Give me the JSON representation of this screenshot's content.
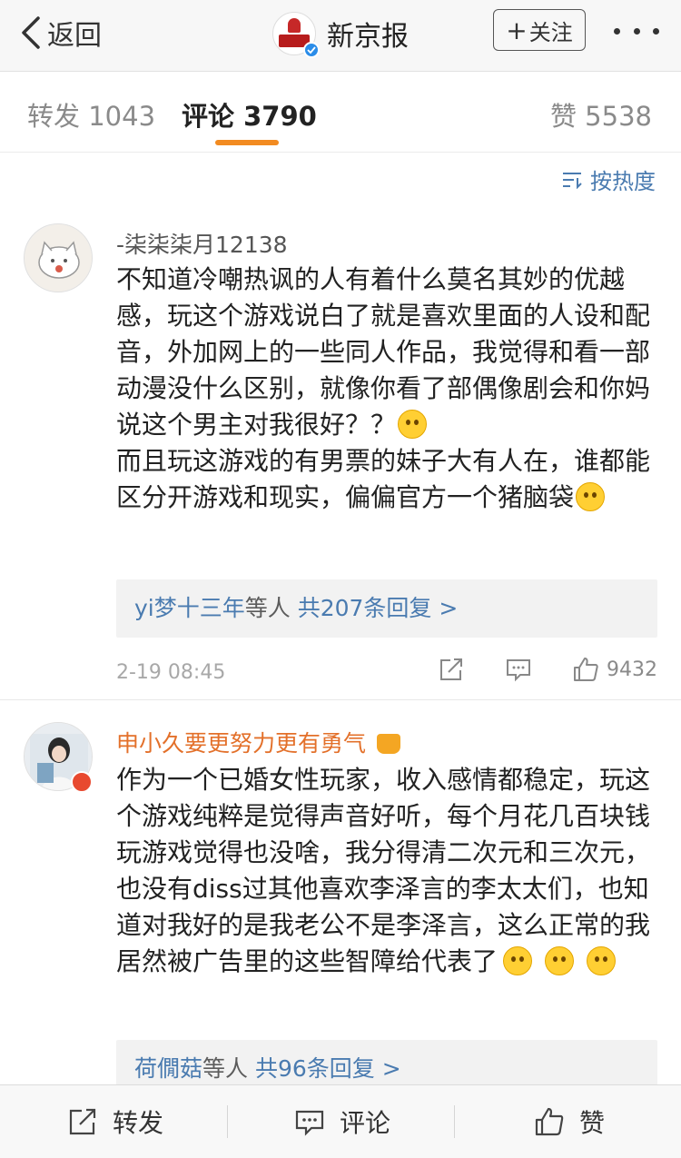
{
  "nav": {
    "back_label": "返回",
    "title": "新京报",
    "logo_text": "新京报",
    "follow_label": "关注",
    "follow_plus": "+"
  },
  "tabs": {
    "repost": "转发 1043",
    "comments": "评论 3790",
    "likes": "赞 5538"
  },
  "sort": {
    "label": "按热度"
  },
  "comments": [
    {
      "username": "-柒柒柒月12138",
      "text_1": "不知道冷嘲热讽的人有着什么莫名其妙的优越感，玩这个游戏说白了就是喜欢里面的人设和配音，外加网上的一些同人作品，我觉得和看一部动漫没什么区别，就像你看了部偶像剧会和你妈说这个男主对我很好？？",
      "text_2": "而且玩这游戏的有男票的妹子大有人在，谁都能区分开游戏和现实，偏偏官方一个猪脑袋",
      "reply_who": "yi梦十三年",
      "reply_mid": "等人",
      "reply_count": "共207条回复 >",
      "time": "2-19 08:45",
      "likes": "9432"
    },
    {
      "username": "申小久要更努力更有勇气",
      "text_1": "作为一个已婚女性玩家，收入感情都稳定，玩这个游戏纯粹是觉得声音好听，每个月花几百块钱玩游戏觉得也没啥，我分得清二次元和三次元，也没有diss过其他喜欢李泽言的李太太们，也知道对我好的是我老公不是李泽言，这么正常的我居然被广告里的这些智障给代表了",
      "reply_who": "荷僩菇",
      "reply_mid": "等人",
      "reply_count": "共96条回复 >"
    }
  ],
  "bottom": {
    "repost": "转发",
    "comment": "评论",
    "like": "赞"
  },
  "colors": {
    "accent_orange": "#f28b21",
    "link_blue": "#4a7bb0",
    "username_orange": "#e3702a",
    "verify_blue": "#2b8de9"
  }
}
